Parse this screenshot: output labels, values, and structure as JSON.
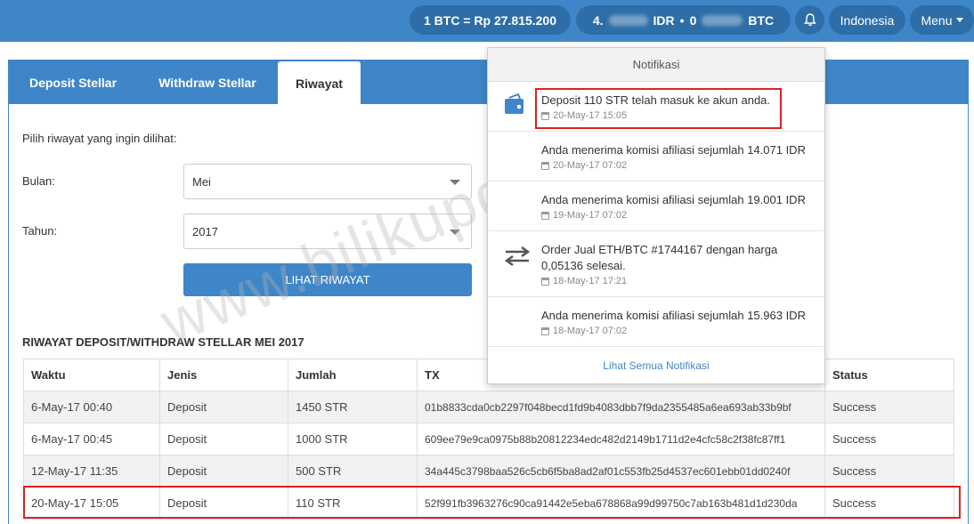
{
  "header": {
    "rate": "1 BTC = Rp 27.815.200",
    "balance_idr_prefix": "4.",
    "balance_idr_suffix": "IDR",
    "separator": "•",
    "balance_btc_prefix": "0",
    "balance_btc_suffix": "BTC",
    "language": "Indonesia",
    "menu": "Menu"
  },
  "tabs": [
    {
      "label": "Deposit Stellar"
    },
    {
      "label": "Withdraw Stellar"
    },
    {
      "label": "Riwayat"
    }
  ],
  "form": {
    "prompt": "Pilih riwayat yang ingin dilihat:",
    "month_label": "Bulan:",
    "month_value": "Mei",
    "year_label": "Tahun:",
    "year_value": "2017",
    "button": "LIHAT RIWAYAT"
  },
  "history": {
    "title": "RIWAYAT DEPOSIT/WITHDRAW STELLAR MEI 2017",
    "columns": [
      "Waktu",
      "Jenis",
      "Jumlah",
      "TX",
      "Status"
    ],
    "rows": [
      [
        "6-May-17 00:40",
        "Deposit",
        "1450 STR",
        "01b8833cda0cb2297f048becd1fd9b4083dbb7f9da2355485a6ea693ab33b9bf",
        "Success"
      ],
      [
        "6-May-17 00:45",
        "Deposit",
        "1000 STR",
        "609ee79e9ca0975b88b20812234edc482d2149b1711d2e4cfc58c2f38fc87ff1",
        "Success"
      ],
      [
        "12-May-17 11:35",
        "Deposit",
        "500 STR",
        "34a445c3798baa526c5cb6f5ba8ad2af01c553fb25d4537ec601ebb01dd0240f",
        "Success"
      ],
      [
        "20-May-17 15:05",
        "Deposit",
        "110 STR",
        "52f991fb3963276c90ca91442e5eba678868a99d99750c7ab163b481d1d230da",
        "Success"
      ]
    ]
  },
  "notifications": {
    "title": "Notifikasi",
    "items": [
      {
        "message": "Deposit 110 STR telah masuk ke akun anda.",
        "time": "20-May-17 15:05",
        "icon": "wallet-icon"
      },
      {
        "message": "Anda menerima komisi afiliasi sejumlah 14.071 IDR",
        "time": "20-May-17 07:02",
        "icon": ""
      },
      {
        "message": "Anda menerima komisi afiliasi sejumlah 19.001 IDR",
        "time": "19-May-17 07:02",
        "icon": ""
      },
      {
        "message": "Order Jual ETH/BTC #1744167 dengan harga 0,05136 selesai.",
        "time": "18-May-17 17:21",
        "icon": "exchange-arrows-icon"
      },
      {
        "message": "Anda menerima komisi afiliasi sejumlah 15.963 IDR",
        "time": "18-May-17 07:02",
        "icon": ""
      }
    ],
    "footer": "Lihat Semua Notifikasi"
  },
  "watermark": "www.bilikupdate.com",
  "colors": {
    "primary": "#3f86c8",
    "highlight": "#e02020"
  }
}
